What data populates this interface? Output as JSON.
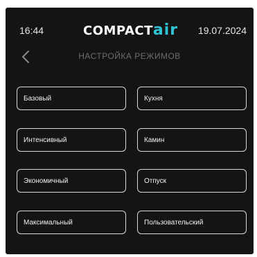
{
  "status": {
    "time": "16:44",
    "date": "19.07.2024"
  },
  "brand": {
    "part1": "COMPACT",
    "part2": "air",
    "accent_color": "#2ec4d6"
  },
  "header": {
    "back_icon": "chevron-left-icon",
    "title": "НАСТРОЙКА РЕЖИМОВ"
  },
  "modes": [
    {
      "label": "Базовый"
    },
    {
      "label": "Кухня"
    },
    {
      "label": "Интенсивный"
    },
    {
      "label": "Камин"
    },
    {
      "label": "Экономичный"
    },
    {
      "label": "Отпуск"
    },
    {
      "label": "Максимальный"
    },
    {
      "label": "Пользовательский"
    }
  ]
}
